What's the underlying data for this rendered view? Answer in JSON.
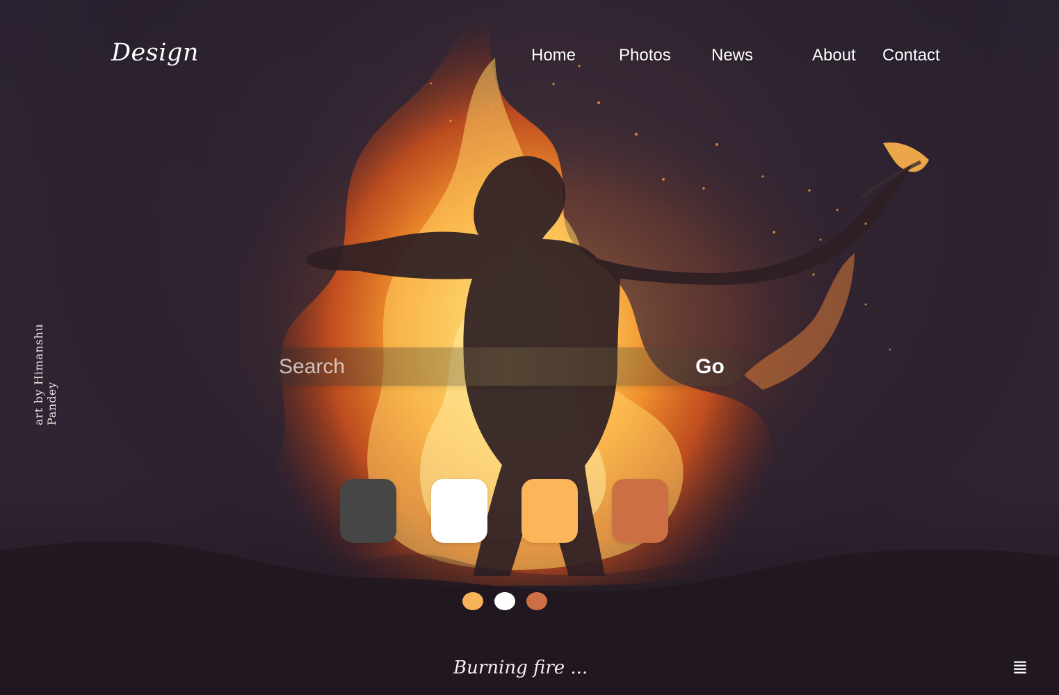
{
  "header": {
    "brand": "Design",
    "nav": [
      {
        "label": "Home"
      },
      {
        "label": "Photos"
      },
      {
        "label": "News"
      },
      {
        "label": "About"
      },
      {
        "label": "Contact"
      }
    ]
  },
  "credit": "art by Himanshu Pandey",
  "search": {
    "placeholder": "Search",
    "button_label": "Go"
  },
  "swatches": [
    {
      "color": "#464646"
    },
    {
      "color": "#ffffff"
    },
    {
      "color": "#fbb55a"
    },
    {
      "color": "#cd6f45"
    }
  ],
  "dots": [
    {
      "color": "#f8b257"
    },
    {
      "color": "#ffffff"
    },
    {
      "color": "#cd6f45"
    }
  ],
  "caption": "Burning fire ...",
  "icons": {
    "menu": "menu-icon"
  }
}
